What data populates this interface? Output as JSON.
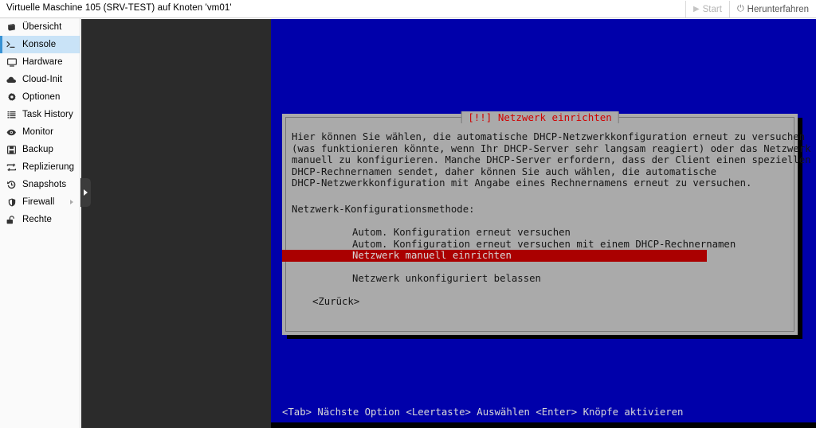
{
  "topbar": {
    "title": "Virtuelle Maschine 105 (SRV-TEST) auf Knoten 'vm01'",
    "start_label": "Start",
    "start_icon": "play-icon",
    "shutdown_label": "Herunterfahren",
    "shutdown_icon": "power-icon"
  },
  "sidebar": {
    "items": [
      {
        "label": "Übersicht",
        "icon": "overview-icon",
        "active": false,
        "has_submenu": false
      },
      {
        "label": "Konsole",
        "icon": "terminal-icon",
        "active": true,
        "has_submenu": false
      },
      {
        "label": "Hardware",
        "icon": "monitor-icon",
        "active": false,
        "has_submenu": false
      },
      {
        "label": "Cloud-Init",
        "icon": "cloud-icon",
        "active": false,
        "has_submenu": false
      },
      {
        "label": "Optionen",
        "icon": "gear-icon",
        "active": false,
        "has_submenu": false
      },
      {
        "label": "Task History",
        "icon": "list-icon",
        "active": false,
        "has_submenu": false
      },
      {
        "label": "Monitor",
        "icon": "eye-icon",
        "active": false,
        "has_submenu": false
      },
      {
        "label": "Backup",
        "icon": "floppy-disk-icon",
        "active": false,
        "has_submenu": false
      },
      {
        "label": "Replizierung",
        "icon": "replicate-icon",
        "active": false,
        "has_submenu": false
      },
      {
        "label": "Snapshots",
        "icon": "history-icon",
        "active": false,
        "has_submenu": false
      },
      {
        "label": "Firewall",
        "icon": "shield-icon",
        "active": false,
        "has_submenu": true
      },
      {
        "label": "Rechte",
        "icon": "unlock-icon",
        "active": false,
        "has_submenu": false
      }
    ]
  },
  "console": {
    "collapse_handle_icon": "expand-right-icon",
    "dialog": {
      "title": "[!!] Netzwerk einrichten",
      "body": "Hier können Sie wählen, die automatische DHCP-Netzwerkkonfiguration erneut zu versuchen\n(was funktionieren könnte, wenn Ihr DHCP-Server sehr langsam reagiert) oder das Netzwerk\nmanuell zu konfigurieren. Manche DHCP-Server erfordern, dass der Client einen speziellen\nDHCP-Rechnernamen sendet, daher können Sie auch wählen, die automatische\nDHCP-Netzwerkkonfiguration mit Angabe eines Rechnernamens erneut zu versuchen.",
      "prompt": "Netzwerk-Konfigurationsmethode:",
      "options": [
        {
          "label": "Autom. Konfiguration erneut versuchen",
          "selected": false
        },
        {
          "label": "Autom. Konfiguration erneut versuchen mit einem DHCP-Rechnernamen",
          "selected": false
        },
        {
          "label": "Netzwerk manuell einrichten",
          "selected": true
        },
        {
          "label": "",
          "selected": false
        },
        {
          "label": "Netzwerk unkonfiguriert belassen",
          "selected": false
        }
      ],
      "back_button": "<Zurück>"
    },
    "status_line": "<Tab> Nächste Option <Leertaste> Auswählen <Enter> Knöpfe aktivieren"
  },
  "colors": {
    "vt_background": "#0000aa",
    "dialog_background": "#aaaaaa",
    "dialog_title": "#d00000",
    "selection": "#aa0000",
    "sidebar_active": "#c9e3f7",
    "sidebar_active_border": "#3892d4"
  }
}
